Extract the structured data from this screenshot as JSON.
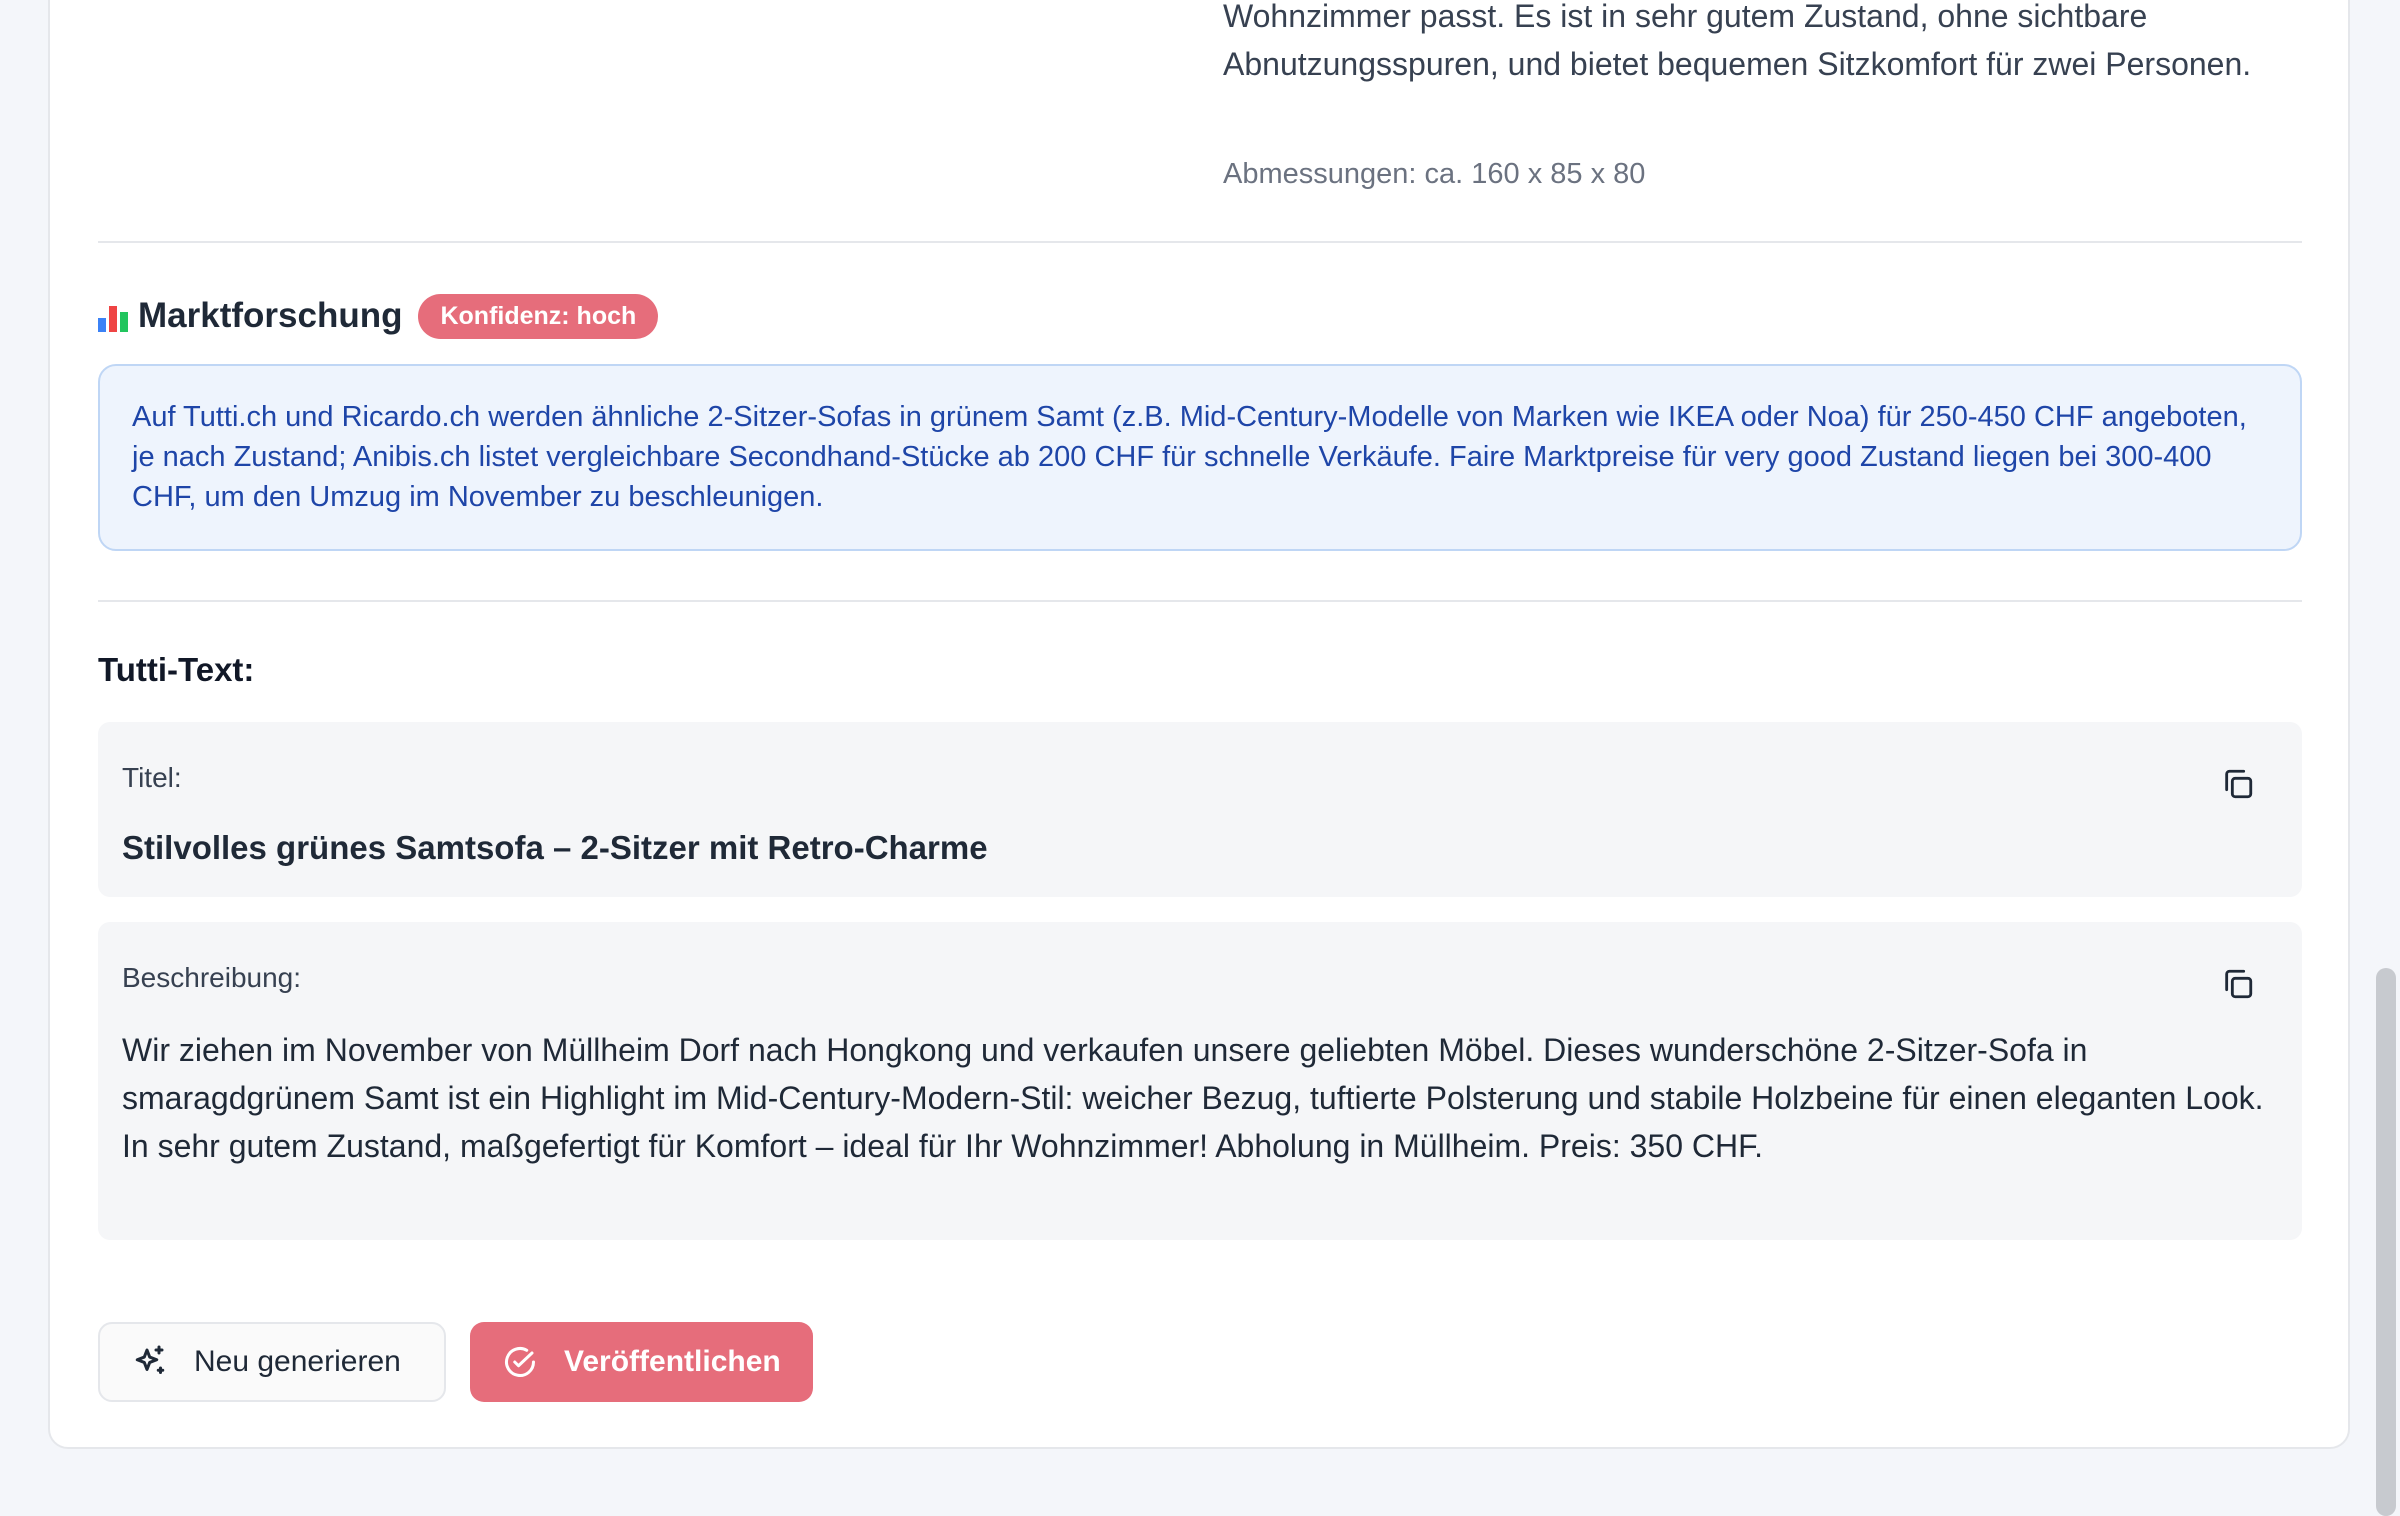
{
  "listing": {
    "description_excerpt": "Wohnzimmer passt. Es ist in sehr gutem Zustand, ohne sichtbare Abnutzungsspuren, und bietet bequemen Sitzkomfort für zwei Personen.",
    "dimensions": "Abmessungen: ca. 160 x 85 x 80"
  },
  "market_research": {
    "title": "Marktforschung",
    "icon": "bar-chart-icon",
    "confidence_badge": "Konfidenz: hoch",
    "text": "Auf Tutti.ch und Ricardo.ch werden ähnliche 2-Sitzer-Sofas in grünem Samt (z.B. Mid-Century-Modelle von Marken wie IKEA oder Noa) für 250-450 CHF angeboten, je nach Zustand; Anibis.ch listet vergleichbare Secondhand-Stücke ab 200 CHF für schnelle Verkäufe. Faire Marktpreise für very good Zustand liegen bei 300-400 CHF, um den Umzug im November zu beschleunigen."
  },
  "tutti": {
    "section_label": "Tutti-Text:",
    "title_label": "Titel:",
    "title_value": "Stilvolles grünes Samtsofa – 2-Sitzer mit Retro-Charme",
    "description_label": "Beschreibung:",
    "description_value": "Wir ziehen im November von Müllheim Dorf nach Hongkong und verkaufen unsere geliebten Möbel. Dieses wunderschöne 2-Sitzer-Sofa in smaragdgrünem Samt ist ein Highlight im Mid-Century-Modern-Stil: weicher Bezug, tuftierte Polsterung und stabile Holzbeine für einen eleganten Look. In sehr gutem Zustand, maßgefertigt für Komfort – ideal für Ihr Wohnzimmer! Abholung in Müllheim. Preis: 350 CHF."
  },
  "actions": {
    "regenerate_label": "Neu generieren",
    "publish_label": "Veröffentlichen"
  },
  "colors": {
    "accent": "#e66d7b",
    "info_bg": "#eef4fd",
    "info_text": "#1e45a8"
  }
}
